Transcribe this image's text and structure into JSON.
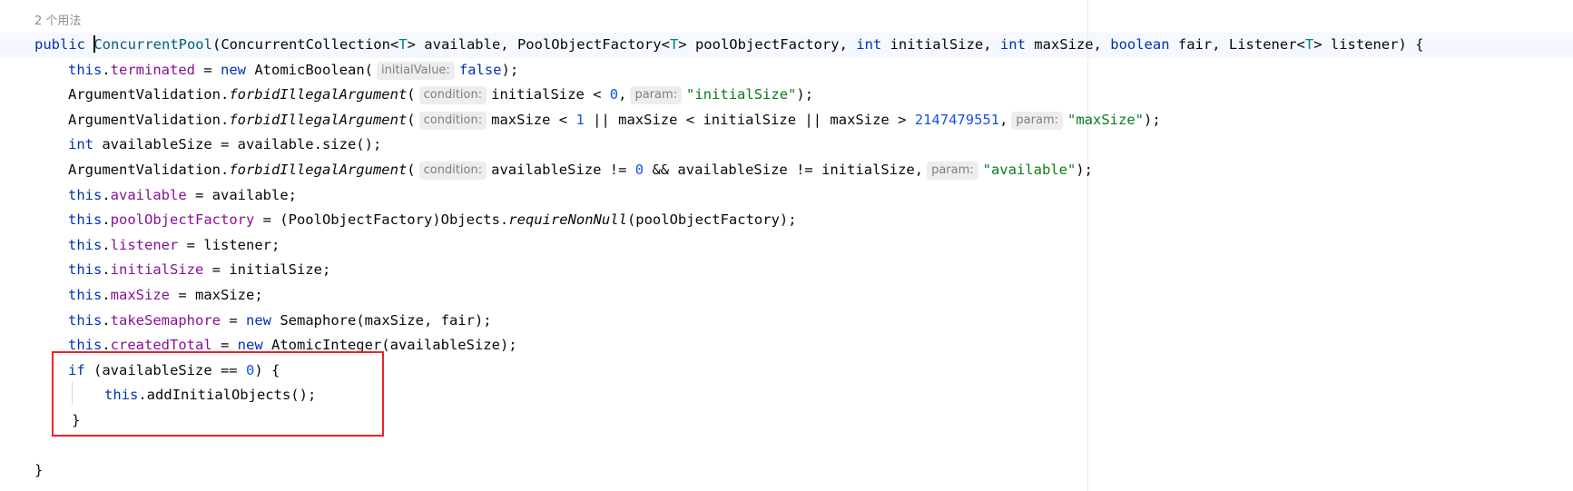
{
  "editor": {
    "usage_hint": "2 个用法",
    "lines": {
      "l1": {
        "kw_public": "public ",
        "name": "ConcurrentPool",
        "p1": "(ConcurrentCollection<",
        "t1": "T",
        "p2": "> available, PoolObjectFactory<",
        "t2": "T",
        "p3": "> poolObjectFactory, ",
        "kw_int1": "int",
        "p4": " initialSize, ",
        "kw_int2": "int",
        "p5": " maxSize, ",
        "kw_boolean": "boolean",
        "p6": " fair, Listener<",
        "t3": "T",
        "p7": "> listener) {"
      },
      "l2": {
        "this": "this",
        "dot": ".",
        "field": "terminated",
        "eq": " = ",
        "kw_new": "new",
        "cls": " AtomicBoolean(",
        "hint": "initialValue:",
        "val": "false",
        "end": ");"
      },
      "l3": {
        "cls": "ArgumentValidation.",
        "method": "forbidIllegalArgument",
        "open": "(",
        "hint1": "condition:",
        "expr": "initialSize < ",
        "num": "0",
        "comma": ",",
        "hint2": "param:",
        "str": "\"initialSize\"",
        "end": ");"
      },
      "l4": {
        "cls": "ArgumentValidation.",
        "method": "forbidIllegalArgument",
        "open": "(",
        "hint1": "condition:",
        "expr1": "maxSize < ",
        "num1": "1",
        "expr2": " || maxSize < initialSize || maxSize > ",
        "num2": "2147479551",
        "comma": ",",
        "hint2": "param:",
        "str": "\"maxSize\"",
        "end": ");"
      },
      "l5": {
        "kw_int": "int",
        "rest": " availableSize = available.size();"
      },
      "l6": {
        "cls": "ArgumentValidation.",
        "method": "forbidIllegalArgument",
        "open": "(",
        "hint1": "condition:",
        "expr1": "availableSize != ",
        "num": "0",
        "expr2": " && availableSize != initialSize,",
        "hint2": "param:",
        "str": "\"available\"",
        "end": ");"
      },
      "l7": {
        "this": "this",
        "dot": ".",
        "field": "available",
        "rest": " = available;"
      },
      "l8": {
        "this": "this",
        "dot": ".",
        "field": "poolObjectFactory",
        "rest1": " = (PoolObjectFactory)Objects.",
        "method": "requireNonNull",
        "rest2": "(poolObjectFactory);"
      },
      "l9": {
        "this": "this",
        "dot": ".",
        "field": "listener",
        "rest": " = listener;"
      },
      "l10": {
        "this": "this",
        "dot": ".",
        "field": "initialSize",
        "rest": " = initialSize;"
      },
      "l11": {
        "this": "this",
        "dot": ".",
        "field": "maxSize",
        "rest": " = maxSize;"
      },
      "l12": {
        "this": "this",
        "dot": ".",
        "field": "takeSemaphore",
        "eq": " = ",
        "kw_new": "new",
        "rest": " Semaphore(maxSize, fair);"
      },
      "l13": {
        "this": "this",
        "dot": ".",
        "field": "createdTotal",
        "eq": " = ",
        "kw_new": "new",
        "rest": " AtomicInteger(availableSize);"
      },
      "l14": {
        "kw_if": "if",
        "p1": " (availableSize == ",
        "num": "0",
        "p2": ") {"
      },
      "l15": {
        "this": "this",
        "rest": ".addInitialObjects();"
      },
      "l16": {
        "brace": "}"
      },
      "l17": {
        "blank": ""
      },
      "l18": {
        "brace": "}"
      }
    }
  },
  "colors": {
    "keyword": "#0033b3",
    "field": "#871094",
    "type_param": "#007e8a",
    "number": "#1750eb",
    "string": "#067d17",
    "highlight_border": "#e8252a"
  }
}
